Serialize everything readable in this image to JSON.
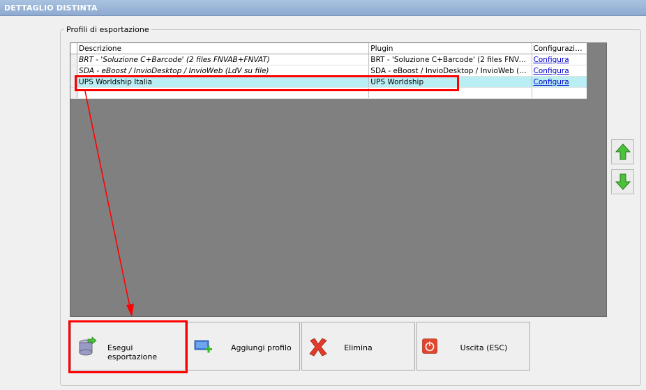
{
  "window": {
    "title": "DETTAGLIO DISTINTA"
  },
  "group": {
    "legend": "Profili di esportazione"
  },
  "grid": {
    "columns": [
      "Descrizione",
      "Plugin",
      "Configurazione"
    ],
    "rows": [
      {
        "descrizione": "BRT - 'Soluzione C+Barcode' (2 files FNVAB+FNVAT)",
        "plugin": "BRT - 'Soluzione C+Barcode' (2 files FNVAB+...",
        "configurazione": "Configura"
      },
      {
        "descrizione": "SDA - eBoost / InvioDesktop / InvioWeb (LdV su file)",
        "plugin": "SDA - eBoost / InvioDesktop / InvioWeb (Ld...",
        "configurazione": "Configura"
      },
      {
        "descrizione": "UPS Worldship Italia",
        "plugin": "UPS Worldship",
        "configurazione": "Configura"
      }
    ]
  },
  "buttons": {
    "esegui": "Esegui esportazione",
    "aggiungi": "Aggiungi profilo",
    "elimina": "Elimina",
    "uscita": "Uscita (ESC)"
  },
  "colors": {
    "selected_row": "#b9eef5",
    "highlight": "#ff0000",
    "grid_background": "#808080"
  }
}
